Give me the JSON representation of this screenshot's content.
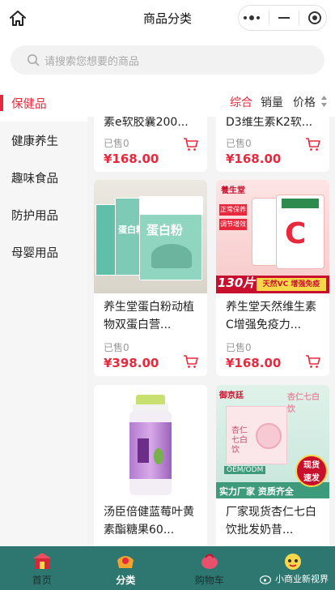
{
  "header": {
    "title": "商品分类"
  },
  "search": {
    "placeholder": "请搜索您想要的商品"
  },
  "sidebar": {
    "items": [
      {
        "label": "保健品",
        "active": true
      },
      {
        "label": "健康养生"
      },
      {
        "label": "趣味食品"
      },
      {
        "label": "防护用品"
      },
      {
        "label": "母婴用品"
      }
    ]
  },
  "sort": {
    "comprehensive": "综合",
    "sales": "销量",
    "price": "价格"
  },
  "products": [
    {
      "name": "素e软胶囊200...",
      "sold": "已售0",
      "price": "¥168.00"
    },
    {
      "name": "D3维生素K2软...",
      "sold": "已售0",
      "price": "¥168.00"
    },
    {
      "name": "养生堂蛋白粉动植物双蛋白营...",
      "sold": "已售0",
      "price": "¥398.00",
      "img_text": [
        "蛋白粉",
        "蛋白粉",
        "蛋白粉"
      ]
    },
    {
      "name": "养生堂天然维生素C增强免疫力...",
      "sold": "已售0",
      "price": "¥168.00",
      "img_text": {
        "brand": "養生堂",
        "tag1": "正常保养",
        "tag2": "调节增效",
        "count": "130片",
        "slogan": "天然VC 增强免疫",
        "letter": "C"
      }
    },
    {
      "name": "汤臣倍健蓝莓叶黄素酯糖果60...",
      "sold": "",
      "price": ""
    },
    {
      "name": "厂家现货杏仁七白饮批发奶昔...",
      "sold": "",
      "price": "",
      "img_text": {
        "brand": "御京廷",
        "box": "杏仁七白饮",
        "right": "杏仁七白饮",
        "oem": "OEM/ODM",
        "bottom": "实力厂家 资质齐全",
        "badge1": "现货",
        "badge2": "速发"
      }
    }
  ],
  "tabbar": {
    "items": [
      {
        "label": "首页"
      },
      {
        "label": "分类",
        "active": true
      },
      {
        "label": "购物车"
      },
      {
        "label": ""
      }
    ]
  },
  "watermark": "小商业新视界",
  "colors": {
    "accent": "#e8283d",
    "tabbar": "#2e7670"
  }
}
